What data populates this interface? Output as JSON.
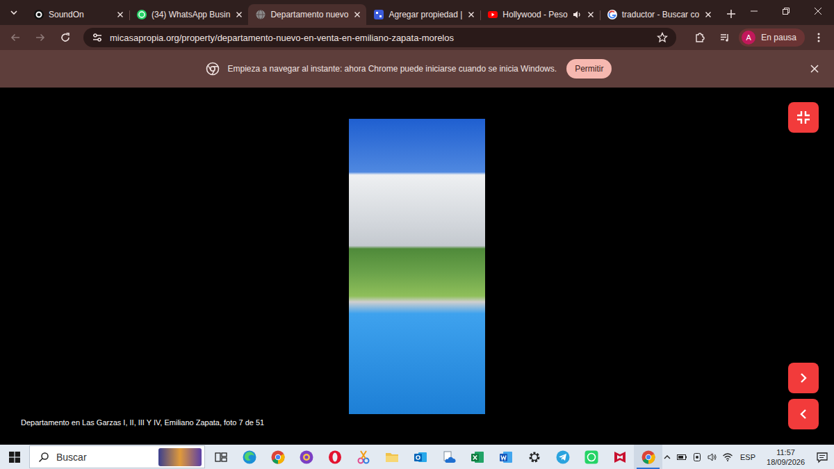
{
  "window": {
    "title": "Departamento nuevo"
  },
  "tabs": [
    {
      "label": "SoundOn",
      "selected": false,
      "kind": "soundon",
      "audio": false
    },
    {
      "label": "(34) WhatsApp Busin",
      "selected": false,
      "kind": "whatsapp",
      "audio": false
    },
    {
      "label": "Departamento nuevo",
      "selected": true,
      "kind": "globe",
      "audio": false
    },
    {
      "label": "Agregar propiedad |",
      "selected": false,
      "kind": "square",
      "audio": false
    },
    {
      "label": "Hollywood - Peso",
      "selected": false,
      "kind": "youtube",
      "audio": true
    },
    {
      "label": "traductor - Buscar co",
      "selected": false,
      "kind": "google",
      "audio": false
    }
  ],
  "address": {
    "url": "micasapropia.org/property/departamento-nuevo-en-venta-en-emiliano-zapata-morelos",
    "bookmarked": false
  },
  "profile": {
    "initial": "A",
    "status": "En pausa"
  },
  "infobar": {
    "message": "Empieza a navegar al instante: ahora Chrome puede iniciarse cuando se inicia Windows.",
    "button": "Permitir"
  },
  "viewer": {
    "caption": "Departamento en Las Garzas I, II, III Y IV, Emiliano Zapata, foto 7 de 51"
  },
  "taskbar": {
    "search_placeholder": "Buscar",
    "apps": [
      {
        "kind": "taskview",
        "active": false
      },
      {
        "kind": "edge",
        "active": false
      },
      {
        "kind": "chrome",
        "active": false
      },
      {
        "kind": "purple",
        "active": false
      },
      {
        "kind": "opera",
        "active": false
      },
      {
        "kind": "snip",
        "active": false
      },
      {
        "kind": "folder",
        "active": false
      },
      {
        "kind": "outlook",
        "active": false
      },
      {
        "kind": "cloud",
        "active": false
      },
      {
        "kind": "excel",
        "active": false
      },
      {
        "kind": "word",
        "active": false
      },
      {
        "kind": "settings",
        "active": false
      },
      {
        "kind": "telegram",
        "active": false
      },
      {
        "kind": "whatsapp",
        "active": false
      },
      {
        "kind": "mcafee",
        "active": false
      },
      {
        "kind": "chrome",
        "active": true
      }
    ],
    "language": "ESP",
    "time": "11:57",
    "date": "18/09/2026"
  }
}
